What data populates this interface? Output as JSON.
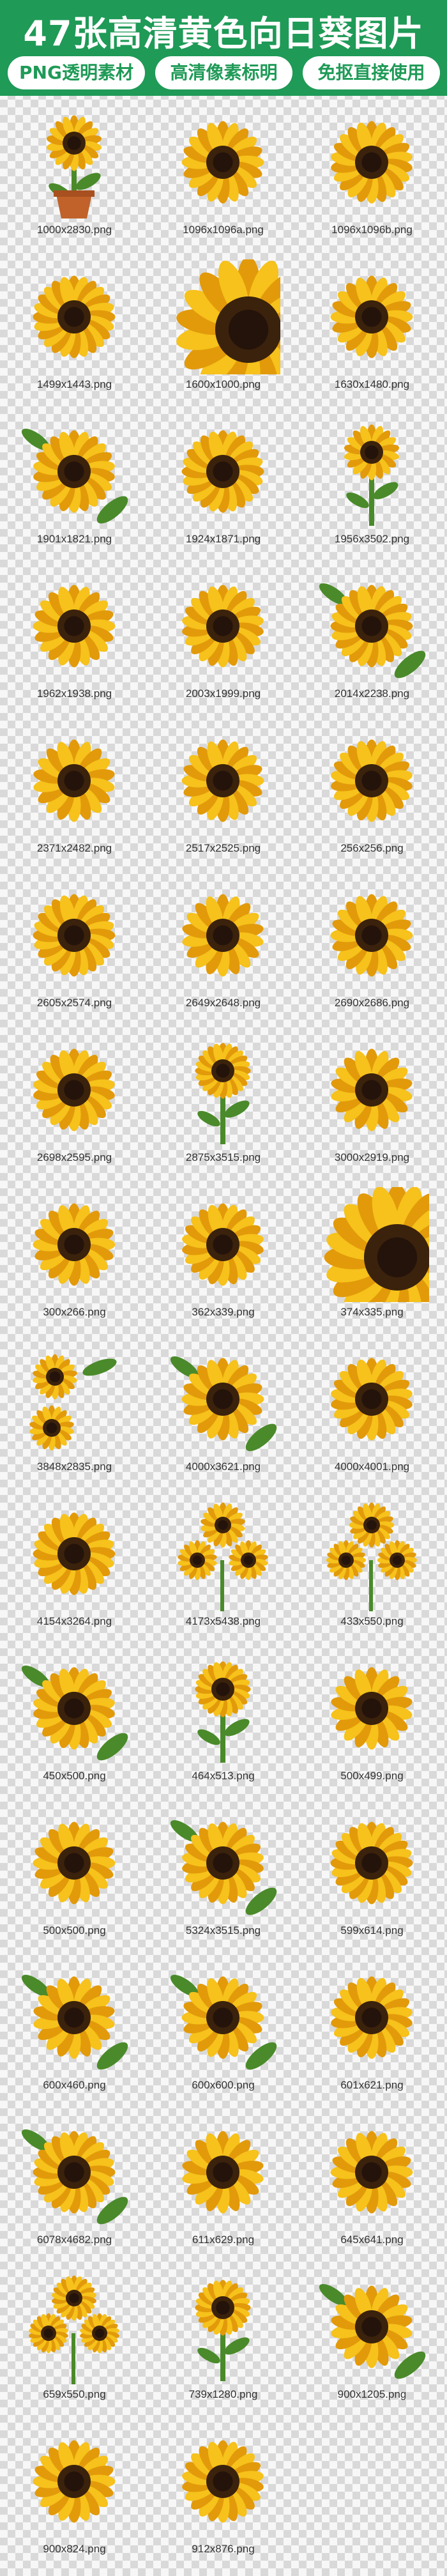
{
  "header": {
    "title": "47张高清黄色向日葵图片",
    "tags": [
      "PNG透明素材",
      "高清像素标明",
      "免抠直接使用"
    ]
  },
  "colors": {
    "header_bg": "#1f9a57",
    "petal": "#f6c21b",
    "petal_dark": "#e29a0a",
    "center": "#3b220c",
    "leaf": "#4a8a2a",
    "pot": "#c0622a"
  },
  "items": [
    {
      "label": "1000x2830.png",
      "icon": "potted-sunflower-icon"
    },
    {
      "label": "1096x1096a.png",
      "icon": "sunflower-icon"
    },
    {
      "label": "1096x1096b.png",
      "icon": "sunflower-icon"
    },
    {
      "label": "1499x1443.png",
      "icon": "sunflower-icon"
    },
    {
      "label": "1600x1000.png",
      "icon": "sunflower-closeup-icon"
    },
    {
      "label": "1630x1480.png",
      "icon": "sunflower-icon"
    },
    {
      "label": "1901x1821.png",
      "icon": "sunflower-with-leaves-icon"
    },
    {
      "label": "1924x1871.png",
      "icon": "sunflower-icon"
    },
    {
      "label": "1956x3502.png",
      "icon": "sunflower-on-stem-icon"
    },
    {
      "label": "1962x1938.png",
      "icon": "sunflower-icon"
    },
    {
      "label": "2003x1999.png",
      "icon": "sunflower-icon"
    },
    {
      "label": "2014x2238.png",
      "icon": "sunflower-with-leaves-icon"
    },
    {
      "label": "2371x2482.png",
      "icon": "sunflower-icon"
    },
    {
      "label": "2517x2525.png",
      "icon": "sunflower-icon"
    },
    {
      "label": "256x256.png",
      "icon": "sunflower-icon"
    },
    {
      "label": "2605x2574.png",
      "icon": "sunflower-icon"
    },
    {
      "label": "2649x2648.png",
      "icon": "sunflower-icon"
    },
    {
      "label": "2690x2686.png",
      "icon": "sunflower-icon"
    },
    {
      "label": "2698x2595.png",
      "icon": "sunflower-icon"
    },
    {
      "label": "2875x3515.png",
      "icon": "sunflower-on-stem-icon"
    },
    {
      "label": "3000x2919.png",
      "icon": "sunflower-icon"
    },
    {
      "label": "300x266.png",
      "icon": "sunflower-icon"
    },
    {
      "label": "362x339.png",
      "icon": "sunflower-icon"
    },
    {
      "label": "374x335.png",
      "icon": "sunflower-closeup-icon"
    },
    {
      "label": "3848x2835.png",
      "icon": "sunflower-pair-icon"
    },
    {
      "label": "4000x3621.png",
      "icon": "sunflower-with-leaves-icon"
    },
    {
      "label": "4000x4001.png",
      "icon": "sunflower-icon"
    },
    {
      "label": "4154x3264.png",
      "icon": "sunflower-icon"
    },
    {
      "label": "4173x5438.png",
      "icon": "sunflower-bouquet-icon"
    },
    {
      "label": "433x550.png",
      "icon": "sunflower-bouquet-icon"
    },
    {
      "label": "450x500.png",
      "icon": "sunflower-with-leaves-icon"
    },
    {
      "label": "464x513.png",
      "icon": "sunflower-on-stem-icon"
    },
    {
      "label": "500x499.png",
      "icon": "sunflower-icon"
    },
    {
      "label": "500x500.png",
      "icon": "sunflower-icon"
    },
    {
      "label": "5324x3515.png",
      "icon": "sunflower-with-leaves-icon"
    },
    {
      "label": "599x614.png",
      "icon": "sunflower-icon"
    },
    {
      "label": "600x460.png",
      "icon": "sunflower-with-leaves-icon"
    },
    {
      "label": "600x600.png",
      "icon": "sunflower-with-leaves-icon"
    },
    {
      "label": "601x621.png",
      "icon": "sunflower-icon"
    },
    {
      "label": "6078x4682.png",
      "icon": "sunflower-with-leaves-icon"
    },
    {
      "label": "611x629.png",
      "icon": "sunflower-icon"
    },
    {
      "label": "645x641.png",
      "icon": "sunflower-icon"
    },
    {
      "label": "659x550.png",
      "icon": "sunflower-bouquet-icon"
    },
    {
      "label": "739x1280.png",
      "icon": "sunflower-on-stem-icon"
    },
    {
      "label": "900x1205.png",
      "icon": "sunflower-with-leaves-icon"
    },
    {
      "label": "900x824.png",
      "icon": "sunflower-icon"
    },
    {
      "label": "912x876.png",
      "icon": "sunflower-icon"
    }
  ]
}
